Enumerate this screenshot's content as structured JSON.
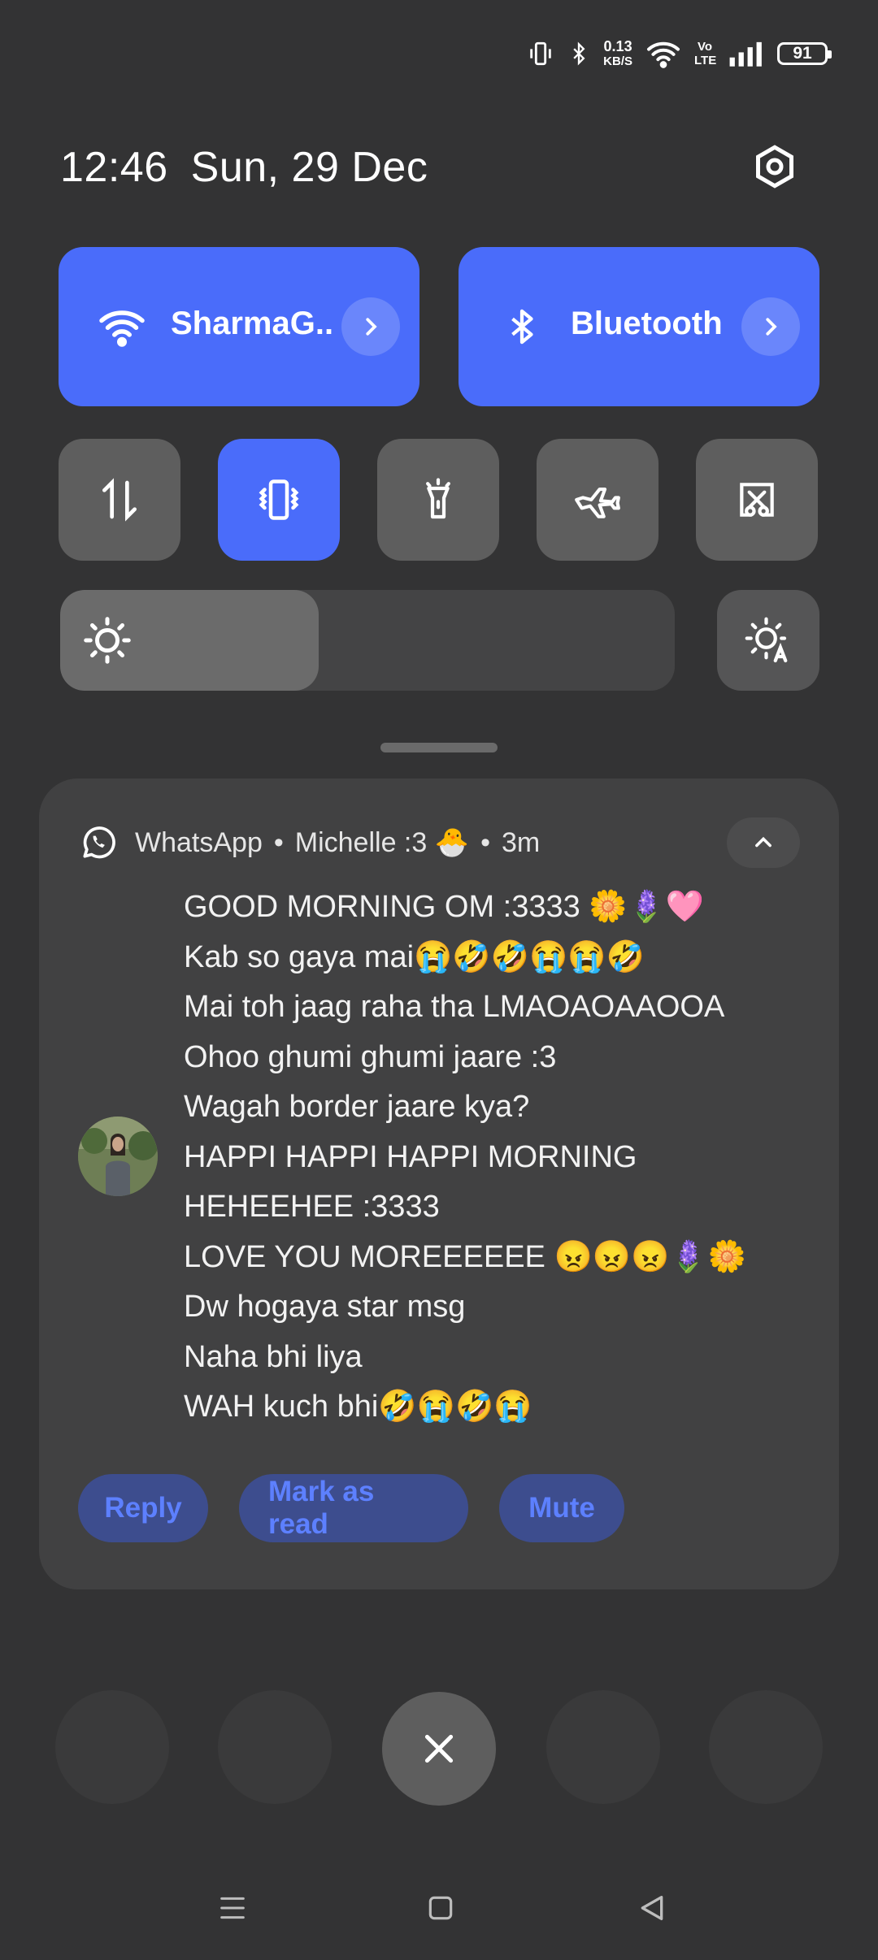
{
  "status_bar": {
    "net_speed_value": "0.13",
    "net_speed_unit": "KB/S",
    "volte": "Vo LTE",
    "battery": "91"
  },
  "header": {
    "time": "12:46",
    "date": "Sun, 29 Dec"
  },
  "quick_tiles": {
    "wifi": {
      "label": "SharmaG..",
      "icon": "wifi-icon"
    },
    "bluetooth": {
      "label": "Bluetooth",
      "icon": "bluetooth-icon"
    },
    "small": [
      {
        "name": "mobile-data",
        "icon": "data-arrows-icon",
        "active": false
      },
      {
        "name": "vibrate",
        "icon": "vibrate-icon",
        "active": true
      },
      {
        "name": "flashlight",
        "icon": "flashlight-icon",
        "active": false
      },
      {
        "name": "airplane-mode",
        "icon": "airplane-icon",
        "active": false
      },
      {
        "name": "screenshot",
        "icon": "screenshot-icon",
        "active": false
      }
    ],
    "brightness_level": 0.42
  },
  "notification": {
    "app": "WhatsApp",
    "sender": "Michelle :3 🐣",
    "age": "3m",
    "messages": [
      "GOOD MORNING OM :3333 🌼🪻🩷",
      "Kab so gaya mai😭🤣🤣😭😭🤣",
      "Mai toh jaag raha tha LMAOAOAAOOA",
      "Ohoo ghumi ghumi jaare :3",
      "Wagah border jaare kya?",
      "HAPPI HAPPI HAPPI MORNING",
      "HEHEEHEE :3333",
      "LOVE YOU MOREEEEEE 😠😠😠🪻🌼",
      "Dw hogaya star msg",
      "Naha bhi liya",
      "WAH kuch bhi🤣😭🤣😭"
    ],
    "actions": {
      "reply": "Reply",
      "mark_read": "Mark as read",
      "mute": "Mute"
    }
  },
  "colors": {
    "accent": "#4a6cfa",
    "background": "#333334",
    "card": "#414142",
    "action_text": "#5d80ff"
  }
}
